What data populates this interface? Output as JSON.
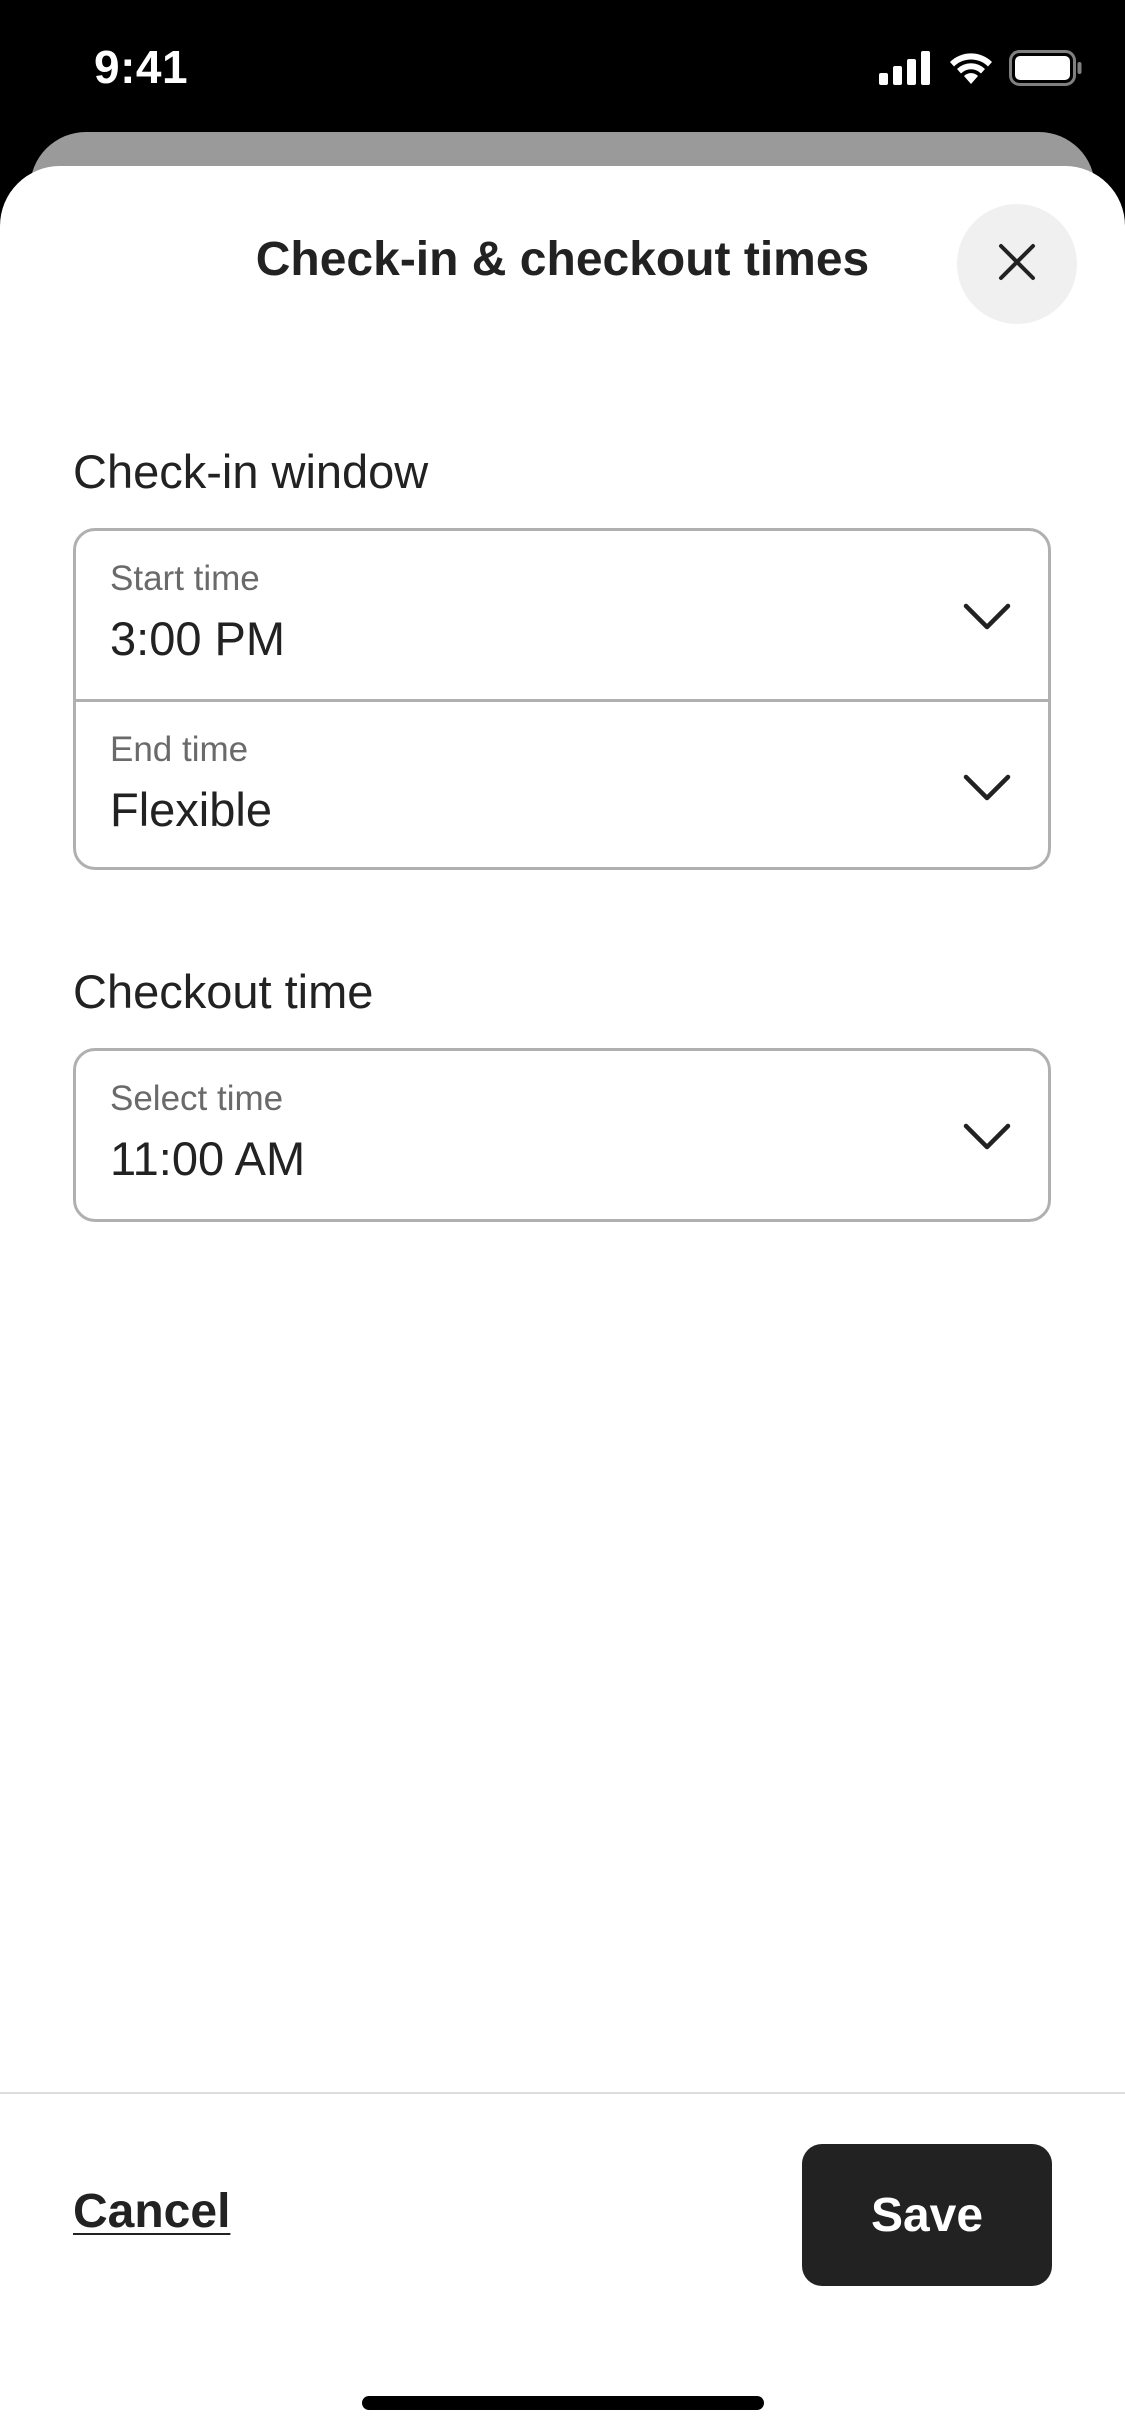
{
  "status_bar": {
    "time": "9:41",
    "icons": [
      "cellular-signal-icon",
      "wifi-icon",
      "battery-icon"
    ]
  },
  "sheet": {
    "title": "Check-in & checkout times",
    "close_icon": "close-icon"
  },
  "checkin": {
    "section_label": "Check-in window",
    "start": {
      "label": "Start time",
      "value": "3:00 PM",
      "icon": "chevron-down-icon"
    },
    "end": {
      "label": "End time",
      "value": "Flexible",
      "icon": "chevron-down-icon"
    }
  },
  "checkout": {
    "section_label": "Checkout time",
    "select": {
      "label": "Select time",
      "value": "11:00 AM",
      "icon": "chevron-down-icon"
    }
  },
  "footer": {
    "cancel_label": "Cancel",
    "save_label": "Save"
  },
  "colors": {
    "text_primary": "#222222",
    "text_secondary": "#6a6a6a",
    "border": "#b0b0b0",
    "save_button_bg": "#222222",
    "close_button_bg": "#f0f0f0"
  }
}
